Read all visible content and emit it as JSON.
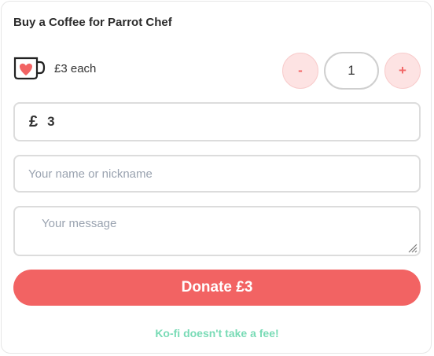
{
  "widget": {
    "title": "Buy a Coffee for Parrot Chef",
    "price_label": "£3 each",
    "icon": "coffee-mug-heart-icon",
    "quantity": {
      "decrement_label": "-",
      "value": "1",
      "increment_label": "+"
    },
    "amount": {
      "currency_symbol": "£",
      "value": "3"
    },
    "name_field": {
      "placeholder": "Your name or nickname"
    },
    "message_field": {
      "placeholder": "Your message"
    },
    "donate_label": "Donate £3",
    "fee_note": "Ko-fi doesn't take a fee!"
  },
  "colors": {
    "accent": "#f26363",
    "accent_light": "#fde3e3",
    "fee_text": "#79dbb6",
    "border": "#dcdcdc"
  }
}
